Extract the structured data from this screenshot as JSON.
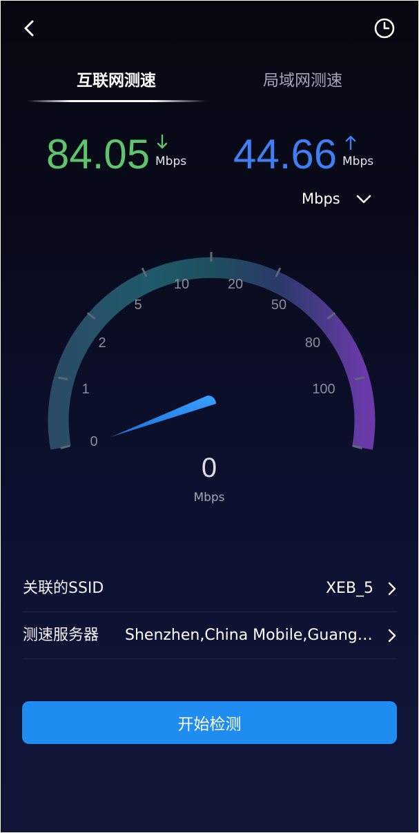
{
  "header": {
    "back_icon": "chevron-left-icon",
    "history_icon": "clock-icon"
  },
  "tabs": [
    {
      "label": "互联网测速",
      "active": true
    },
    {
      "label": "局域网测速",
      "active": false
    }
  ],
  "results": {
    "download": {
      "value": "84.05",
      "unit": "Mbps",
      "color": "#5ec46e",
      "icon": "arrow-down-icon"
    },
    "upload": {
      "value": "44.66",
      "unit": "Mbps",
      "color": "#3f7ff0",
      "icon": "arrow-up-icon"
    }
  },
  "unit_selector": {
    "selected": "Mbps",
    "icon": "chevron-down-icon"
  },
  "gauge": {
    "ticks": [
      "0",
      "1",
      "2",
      "5",
      "10",
      "20",
      "50",
      "80",
      "100"
    ],
    "current_value": "0",
    "unit": "Mbps",
    "needle_value": 0
  },
  "info": {
    "ssid": {
      "label": "关联的SSID",
      "value": "XEB_5"
    },
    "server": {
      "label": "测速服务器",
      "value": "Shenzhen,China Mobile,Guangdong"
    }
  },
  "start_button": {
    "label": "开始检测",
    "color": "#1e8cf0"
  },
  "colors": {
    "background": "#090b1d",
    "download": "#5ec46e",
    "upload": "#3f7ff0",
    "accent": "#1e8cf0"
  }
}
